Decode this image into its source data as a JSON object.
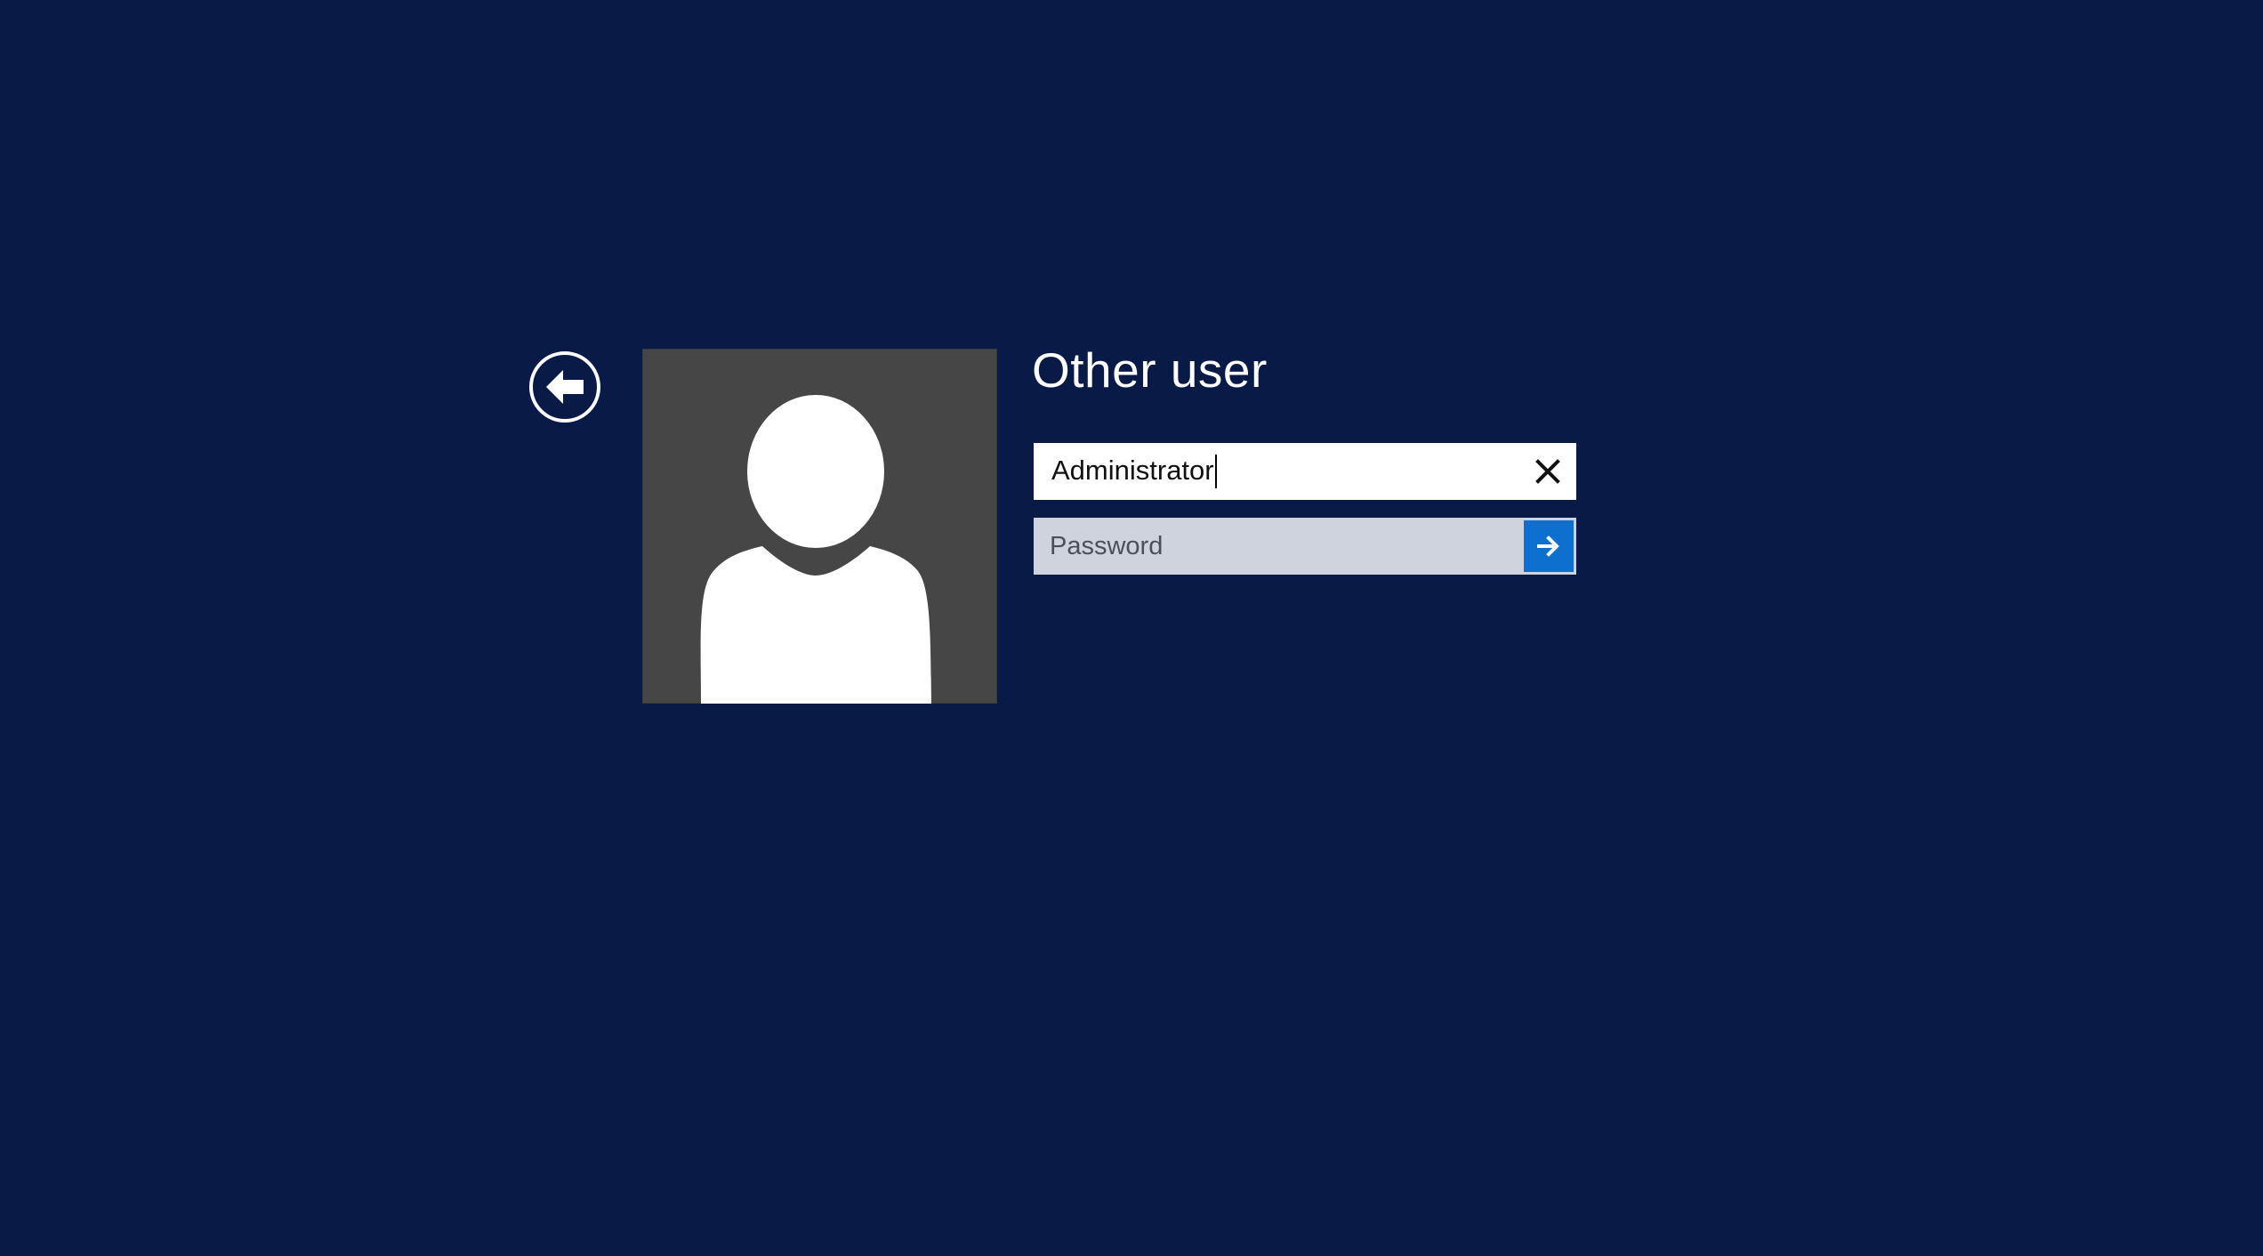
{
  "login": {
    "title": "Other user",
    "username_value": "Administrator",
    "password_placeholder": "Password"
  },
  "icons": {
    "back": "back-arrow-circle-icon",
    "avatar": "user-silhouette-icon",
    "clear": "close-icon",
    "submit": "arrow-right-icon"
  },
  "colors": {
    "background": "#0a1a47",
    "avatar_tile": "#464646",
    "password_field": "#cfd3dd",
    "submit_button": "#0d6fce"
  }
}
